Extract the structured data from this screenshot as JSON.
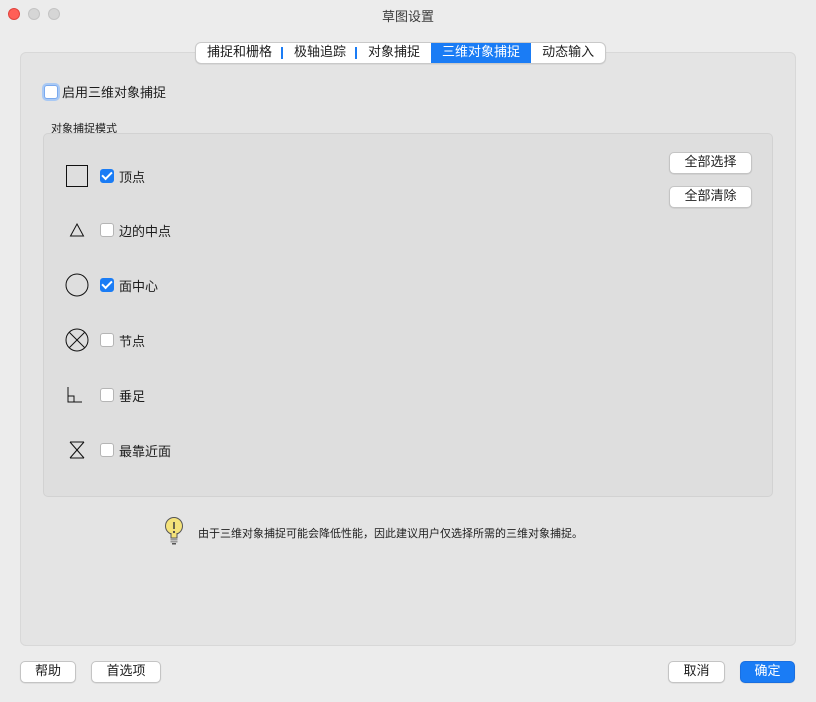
{
  "window": {
    "title": "草图设置"
  },
  "tabs": [
    {
      "label": "捕捉和栅格",
      "active": false
    },
    {
      "label": "极轴追踪",
      "active": false
    },
    {
      "label": "对象捕捉",
      "active": false
    },
    {
      "label": "三维对象捕捉",
      "active": true
    },
    {
      "label": "动态输入",
      "active": false
    }
  ],
  "enable_3d_snap": {
    "label": "启用三维对象捕捉",
    "checked": false
  },
  "group": {
    "title": "对象捕捉模式",
    "modes": [
      {
        "label": "顶点",
        "checked": true,
        "icon": "square-icon"
      },
      {
        "label": "边的中点",
        "checked": false,
        "icon": "triangle-icon"
      },
      {
        "label": "面中心",
        "checked": true,
        "icon": "circle-icon"
      },
      {
        "label": "节点",
        "checked": false,
        "icon": "circle-x-icon"
      },
      {
        "label": "垂足",
        "checked": false,
        "icon": "perpendicular-icon"
      },
      {
        "label": "最靠近面",
        "checked": false,
        "icon": "hourglass-icon"
      }
    ],
    "select_all": "全部选择",
    "clear_all": "全部清除"
  },
  "tip": {
    "icon": "lightbulb-icon",
    "text": "由于三维对象捕捉可能会降低性能，因此建议用户仅选择所需的三维对象捕捉。"
  },
  "footer": {
    "help": "帮助",
    "options": "首选项",
    "cancel": "取消",
    "ok": "确定"
  },
  "colors": {
    "accent": "#1a7cf5",
    "close": "#ff5f57"
  }
}
